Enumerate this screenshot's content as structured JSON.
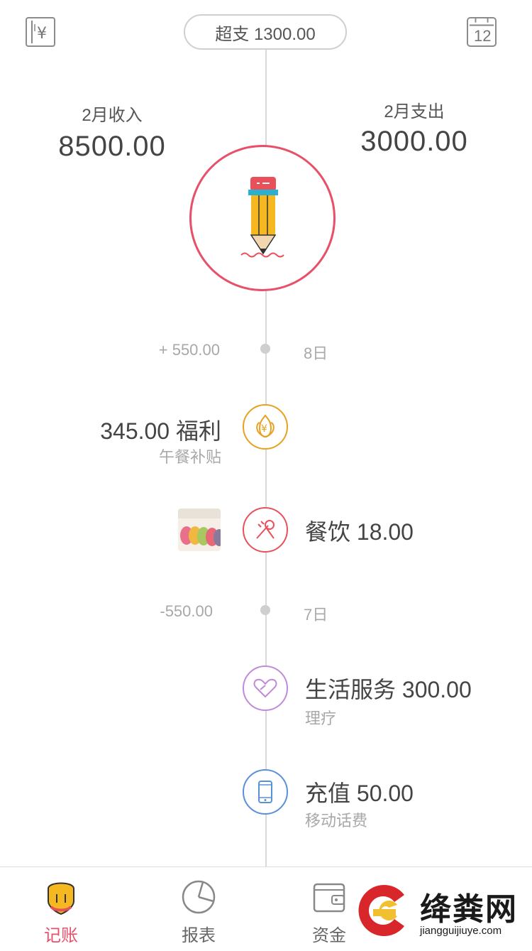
{
  "header": {
    "ledger_icon": "yen-book-icon",
    "overspend_label": "超支 1300.00",
    "calendar_day": "12"
  },
  "summary": {
    "income_label": "2月收入",
    "income_value": "8500.00",
    "expense_label": "2月支出",
    "expense_value": "3000.00"
  },
  "timeline": {
    "days": [
      {
        "amount": "+ 550.00",
        "label": "8日"
      },
      {
        "amount": "-550.00",
        "label": "7日"
      }
    ],
    "entries": [
      {
        "title": "345.00 福利",
        "subtitle": "午餐补贴",
        "icon": "yen-lotus-icon",
        "color": "#e8a020"
      },
      {
        "title": "餐饮 18.00",
        "subtitle": "",
        "icon": "fork-spoon-icon",
        "color": "#e8505a"
      },
      {
        "title": "生活服务 300.00",
        "subtitle": "理疗",
        "icon": "heart-icon",
        "color": "#c08ad8"
      },
      {
        "title": "充值 50.00",
        "subtitle": "移动话费",
        "icon": "phone-icon",
        "color": "#5a90d8"
      }
    ]
  },
  "tabs": [
    {
      "label": "记账",
      "icon": "pencil-tab-icon",
      "active": true
    },
    {
      "label": "报表",
      "icon": "pie-chart-icon",
      "active": false
    },
    {
      "label": "资金",
      "icon": "wallet-icon",
      "active": false
    }
  ],
  "watermark": {
    "brand": "绛粪网",
    "url": "jiangguijiuye.com"
  },
  "colors": {
    "accent": "#e8506a",
    "active_tab": "#e8506a"
  }
}
